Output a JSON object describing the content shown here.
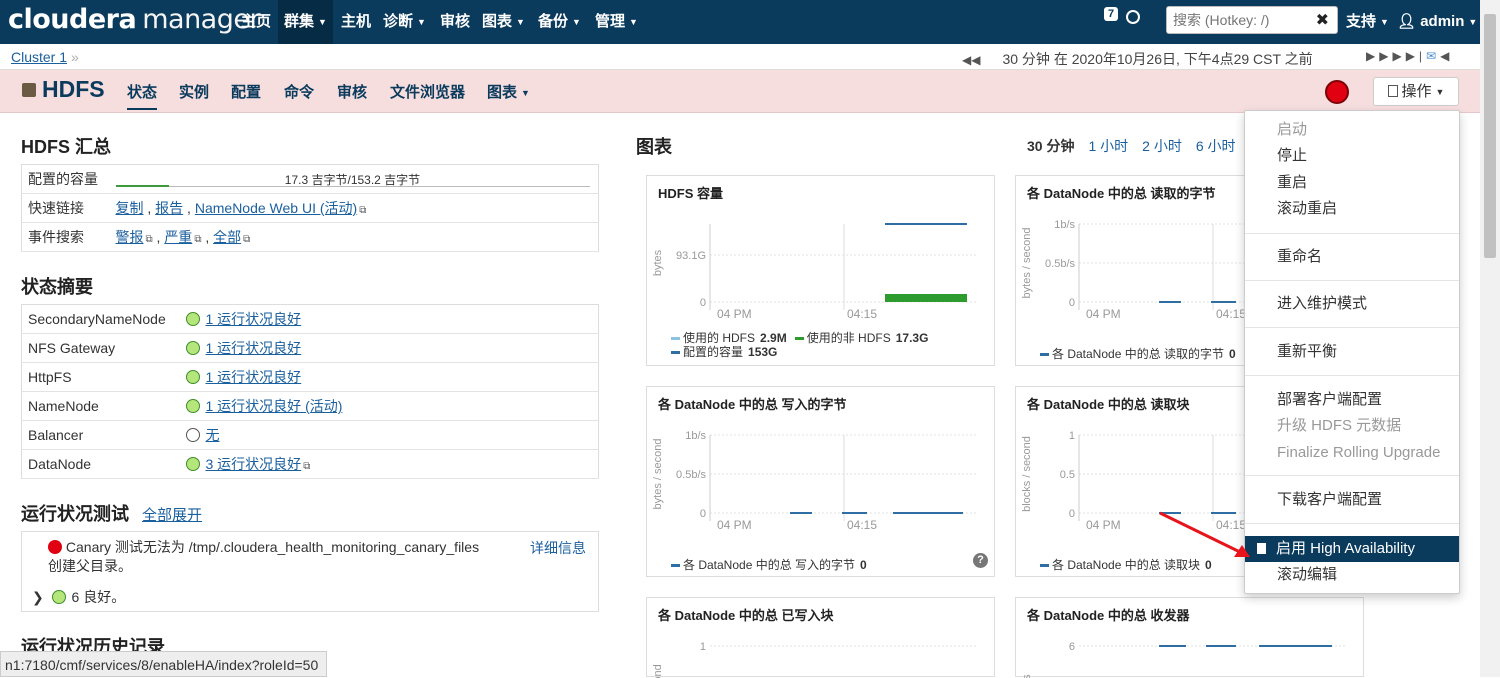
{
  "topnav": {
    "logo_left": "cloudera",
    "logo_right": "manager",
    "items": [
      "主页",
      "群集",
      "主机",
      "诊断",
      "审核",
      "图表",
      "备份",
      "管理"
    ],
    "badge_count": "7",
    "search_placeholder": "搜索 (Hotkey: /)",
    "support": "支持",
    "user": "admin",
    "icons": [
      "clock-icon",
      "user-icon",
      "close-icon"
    ]
  },
  "breadcrumb": {
    "cluster": "Cluster 1",
    "sep": "»",
    "time_text": "30 分钟 在 2020年10月26日, 下午4点29 CST 之前"
  },
  "service": {
    "title": "HDFS",
    "tabs": [
      "状态",
      "实例",
      "配置",
      "命令",
      "审核",
      "文件浏览器",
      "图表"
    ],
    "ops_label": "操作",
    "status_color": "#e00012"
  },
  "summary": {
    "heading": "HDFS 汇总",
    "capacity_label": "配置的容量",
    "capacity_text": "17.3 吉字节/153.2 吉字节",
    "capacity_fraction": 0.113,
    "quicklinks_label": "快速链接",
    "quicklinks": [
      "复制",
      "报告",
      "NameNode Web UI (活动)"
    ],
    "events_label": "事件搜索",
    "events": [
      "警报",
      "严重",
      "全部"
    ]
  },
  "status_summary": {
    "heading": "状态摘要",
    "rows": [
      {
        "name": "SecondaryNameNode",
        "status": "1 运行状况良好",
        "ok": true
      },
      {
        "name": "NFS Gateway",
        "status": "1 运行状况良好",
        "ok": true
      },
      {
        "name": "HttpFS",
        "status": "1 运行状况良好",
        "ok": true
      },
      {
        "name": "NameNode",
        "status": "1 运行状况良好 (活动)",
        "ok": true
      },
      {
        "name": "Balancer",
        "status": "无",
        "ok": false
      },
      {
        "name": "DataNode",
        "status": "3 运行状况良好",
        "ok": true
      }
    ]
  },
  "health_tests": {
    "heading": "运行状况测试",
    "expand_all": "全部展开",
    "canary_line1": "Canary 测试无法为 /tmp/.cloudera_health_monitoring_canary_files",
    "canary_line2": "创建父目录。",
    "details": "详细信息",
    "good": "6 良好。"
  },
  "history_heading": "运行状况历史记录",
  "charts": {
    "heading": "图表",
    "ranges": [
      "30 分钟",
      "1 小时",
      "2 小时",
      "6 小时"
    ],
    "x_ticks": [
      "04 PM",
      "04:15"
    ],
    "items": [
      {
        "title": "HDFS 容量",
        "ylabel": "bytes",
        "yticks": [
          "0",
          "93.1G"
        ],
        "legend": [
          {
            "label": "使用的 HDFS",
            "value": "2.9M",
            "color": "#8bc3e8"
          },
          {
            "label": "使用的非 HDFS",
            "value": "17.3G",
            "color": "#2e9b2e"
          },
          {
            "label": "配置的容量",
            "value": "153G",
            "color": "#2f6ea4"
          }
        ]
      },
      {
        "title": "各 DataNode 中的总 读取的字节",
        "ylabel": "bytes / second",
        "yticks": [
          "0",
          "0.5b/s",
          "1b/s"
        ],
        "legend": [
          {
            "label": "各 DataNode 中的总 读取的字节",
            "value": "0",
            "color": "#2f6ea4"
          }
        ]
      },
      {
        "title": "各 DataNode 中的总 写入的字节",
        "ylabel": "bytes / second",
        "yticks": [
          "0",
          "0.5b/s",
          "1b/s"
        ],
        "legend": [
          {
            "label": "各 DataNode 中的总 写入的字节",
            "value": "0",
            "color": "#2f6ea4"
          }
        ]
      },
      {
        "title": "各 DataNode 中的总 读取块",
        "ylabel": "blocks / second",
        "yticks": [
          "0",
          "0.5",
          "1"
        ],
        "legend": [
          {
            "label": "各 DataNode 中的总 读取块",
            "value": "0",
            "color": "#2f6ea4"
          }
        ]
      },
      {
        "title": "各 DataNode 中的总 已写入块",
        "ylabel": "second",
        "yticks": [
          "1"
        ],
        "legend": []
      },
      {
        "title": "各 DataNode 中的总 收发器",
        "ylabel": "ers",
        "yticks": [
          "6"
        ],
        "legend": []
      }
    ]
  },
  "ops_menu": {
    "items": [
      {
        "label": "启动",
        "disabled": true
      },
      {
        "label": "停止",
        "disabled": false
      },
      {
        "label": "重启",
        "disabled": false
      },
      {
        "label": "滚动重启",
        "disabled": false
      },
      {
        "label": "重命名",
        "disabled": false
      },
      {
        "label": "进入维护模式",
        "disabled": false
      },
      {
        "label": "重新平衡",
        "disabled": false
      },
      {
        "label": "部署客户端配置",
        "disabled": false
      },
      {
        "label": "升级 HDFS 元数据",
        "disabled": true
      },
      {
        "label": "Finalize Rolling Upgrade",
        "disabled": true
      },
      {
        "label": "下载客户端配置",
        "disabled": false
      },
      {
        "label": "启用 High Availability",
        "disabled": false,
        "highlighted": true
      },
      {
        "label": "滚动编辑",
        "disabled": false
      }
    ]
  },
  "status_url": "n1:7180/cmf/services/8/enableHA/index?roleId=50"
}
